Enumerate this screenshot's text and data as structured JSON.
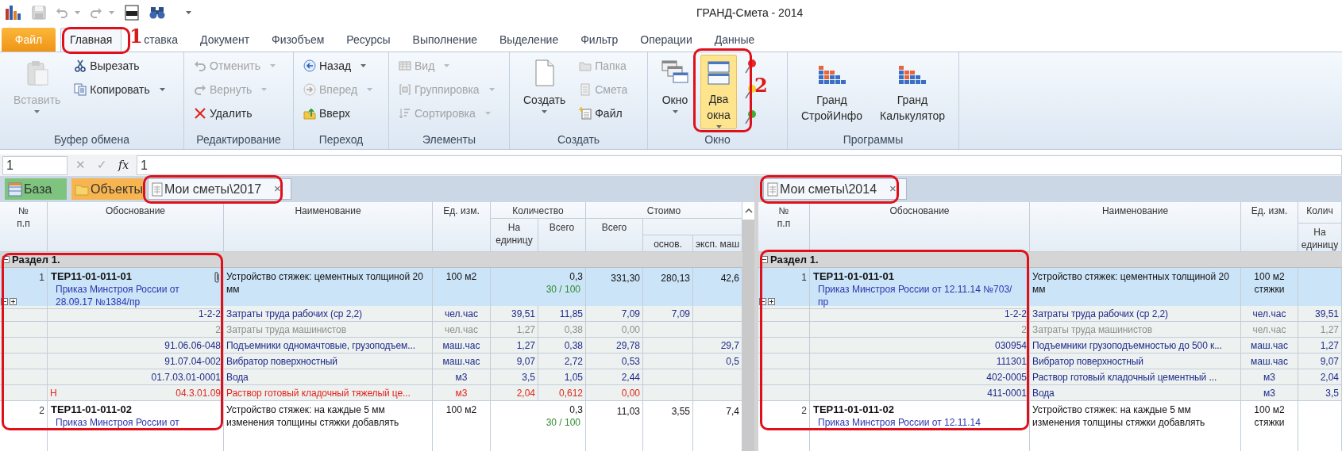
{
  "window": {
    "title": "ГРАНД-Смета - 2014"
  },
  "ribbon": {
    "tabs": [
      {
        "label": "Файл",
        "kind": "file",
        "selected": false
      },
      {
        "label": "Главная",
        "kind": "tab",
        "selected": true
      },
      {
        "label": "ставка",
        "kind": "tab",
        "selected": false
      },
      {
        "label": "Документ",
        "kind": "tab",
        "selected": false
      },
      {
        "label": "Физобъем",
        "kind": "tab",
        "selected": false
      },
      {
        "label": "Ресурсы",
        "kind": "tab",
        "selected": false
      },
      {
        "label": "Выполнение",
        "kind": "tab",
        "selected": false
      },
      {
        "label": "Выделение",
        "kind": "tab",
        "selected": false
      },
      {
        "label": "Фильтр",
        "kind": "tab",
        "selected": false
      },
      {
        "label": "Операции",
        "kind": "tab",
        "selected": false
      },
      {
        "label": "Данные",
        "kind": "tab",
        "selected": false
      }
    ],
    "groups": [
      {
        "label": "Буфер обмена",
        "buttons": [
          {
            "kind": "large",
            "label": "Вставить",
            "disabled": true,
            "dropdown": true,
            "pressed": false
          },
          {
            "kind": "small",
            "label": "Вырезать",
            "disabled": false,
            "dropdown": false,
            "pressed": false
          },
          {
            "kind": "small",
            "label": "Копировать",
            "disabled": false,
            "dropdown": true,
            "pressed": false
          }
        ]
      },
      {
        "label": "Редактирование",
        "buttons": [
          {
            "kind": "small",
            "label": "Отменить",
            "disabled": true,
            "dropdown": true,
            "pressed": false
          },
          {
            "kind": "small",
            "label": "Вернуть",
            "disabled": true,
            "dropdown": true,
            "pressed": false
          },
          {
            "kind": "small",
            "label": "Удалить",
            "disabled": false,
            "dropdown": false,
            "pressed": false
          }
        ]
      },
      {
        "label": "Переход",
        "buttons": [
          {
            "kind": "small",
            "label": "Назад",
            "disabled": false,
            "dropdown": true,
            "pressed": false
          },
          {
            "kind": "small",
            "label": "Вперед",
            "disabled": true,
            "dropdown": true,
            "pressed": false
          },
          {
            "kind": "small",
            "label": "Вверх",
            "disabled": false,
            "dropdown": false,
            "pressed": false
          }
        ]
      },
      {
        "label": "Элементы",
        "buttons": [
          {
            "kind": "small",
            "label": "Вид",
            "disabled": true,
            "dropdown": true,
            "pressed": false
          },
          {
            "kind": "small",
            "label": "Группировка",
            "disabled": true,
            "dropdown": true,
            "pressed": false
          },
          {
            "kind": "small",
            "label": "Сортировка",
            "disabled": true,
            "dropdown": true,
            "pressed": false
          }
        ]
      },
      {
        "label": "Создать",
        "buttons": [
          {
            "kind": "large",
            "label": "Создать",
            "disabled": false,
            "dropdown": true,
            "pressed": false
          },
          {
            "kind": "small",
            "label": "Папка",
            "disabled": true,
            "dropdown": false,
            "pressed": false
          },
          {
            "kind": "small",
            "label": "Смета",
            "disabled": true,
            "dropdown": false,
            "pressed": false
          },
          {
            "kind": "small",
            "label": "Файл",
            "disabled": false,
            "dropdown": false,
            "pressed": false
          }
        ]
      },
      {
        "label": "Окно",
        "buttons": [
          {
            "kind": "large",
            "label": "Окно",
            "disabled": false,
            "dropdown": true,
            "pressed": false
          },
          {
            "kind": "large",
            "label": "Два окна",
            "disabled": false,
            "dropdown": true,
            "pressed": true
          },
          {
            "kind": "pin",
            "color": "#e8262a"
          },
          {
            "kind": "pin",
            "color": "#f2d22a"
          },
          {
            "kind": "pin",
            "color": "#3fae35"
          }
        ]
      },
      {
        "label": "Программы",
        "buttons": [
          {
            "kind": "large",
            "label": "Гранд СтройИнфо",
            "disabled": false,
            "dropdown": false,
            "pressed": false
          },
          {
            "kind": "large",
            "label": "Гранд Калькулятор",
            "disabled": false,
            "dropdown": false,
            "pressed": false
          }
        ]
      }
    ]
  },
  "formula_bar": {
    "cell": "1",
    "buttons": [
      {
        "glyph": "✕",
        "disabled": true
      },
      {
        "glyph": "✓",
        "disabled": true
      },
      {
        "glyph": "fx",
        "disabled": false
      }
    ],
    "value": "1"
  },
  "panes": [
    {
      "tabs": [
        {
          "label": "База",
          "kind": "base",
          "selected": false
        },
        {
          "label": "Объекты",
          "kind": "objects",
          "selected": false
        },
        {
          "label": "Мои сметы\\2017",
          "kind": "estimate",
          "selected": true,
          "close": "×"
        }
      ],
      "columns": [
        {
          "label": "№ п.п"
        },
        {
          "label": "Обоснование"
        },
        {
          "label": "Наименование"
        },
        {
          "label": "Ед. изм."
        },
        {
          "label": "Количество",
          "children": [
            {
              "label": "На единицу"
            },
            {
              "label": "Всего"
            }
          ]
        },
        {
          "label": "Стоимо",
          "children": [
            {
              "label": "Всего"
            },
            {
              "children": [
                {
                  "label": "основ."
                },
                {
                  "label": "эксп. маш"
                }
              ]
            }
          ]
        }
      ],
      "rows": [
        {
          "kind": "section",
          "label": "Раздел 1."
        },
        {
          "kind": "item",
          "selected": true,
          "number": "1",
          "code": "ТЕР11-01-011-01",
          "order": "Приказ Минстроя России от 28.09.17 №1384/пр",
          "attachment": true,
          "tree_toggles": true,
          "name": "Устройство стяжек: цементных толщиной 20 мм",
          "unit": "100 м2",
          "quantity": "0,3",
          "ratio": "30 / 100",
          "total": "331,30",
          "base": "280,13",
          "machine": "42,6"
        },
        {
          "kind": "resource",
          "greyed": false,
          "missing": false,
          "code": "1-2-2",
          "name": "Затраты труда рабочих (ср 2,2)",
          "unit": "чел.час",
          "per_unit": "39,51",
          "quantity": "11,85",
          "total": "7,09",
          "base": "7,09"
        },
        {
          "kind": "resource",
          "greyed": true,
          "missing": false,
          "code": "2",
          "name": "Затраты труда машинистов",
          "unit": "чел.час",
          "per_unit": "1,27",
          "quantity": "0,38",
          "total": "0,00"
        },
        {
          "kind": "resource",
          "greyed": false,
          "missing": false,
          "code": "91.06.06-048",
          "name": "Подъемники одномачтовые, грузоподъем...",
          "unit": "маш.час",
          "per_unit": "1,27",
          "quantity": "0,38",
          "total": "29,78",
          "machine": "29,7"
        },
        {
          "kind": "resource",
          "greyed": false,
          "missing": false,
          "code": "91.07.04-002",
          "name": "Вибратор поверхностный",
          "unit": "маш.час",
          "per_unit": "9,07",
          "quantity": "2,72",
          "total": "0,53",
          "machine": "0,5"
        },
        {
          "kind": "resource",
          "greyed": false,
          "missing": false,
          "code": "01.7.03.01-0001",
          "name": "Вода",
          "unit": "м3",
          "per_unit": "3,5",
          "quantity": "1,05",
          "total": "2,44"
        },
        {
          "kind": "resource",
          "greyed": false,
          "missing": true,
          "marker": "Н",
          "code": "04.3.01.09",
          "name": "Раствор готовый кладочный тяжелый це...",
          "unit": "м3",
          "per_unit": "2,04",
          "quantity": "0,612",
          "total": "0,00"
        },
        {
          "kind": "item",
          "selected": false,
          "number": "2",
          "code": "ТЕР11-01-011-02",
          "order": "Приказ Минстроя России от",
          "name": "Устройство стяжек: на каждые 5 мм изменения толщины стяжки добавлять",
          "unit": "100 м2",
          "quantity": "0,3",
          "ratio": "30 / 100",
          "total": "11,03",
          "base": "3,55",
          "machine": "7,4"
        }
      ]
    },
    {
      "tabs": [
        {
          "label": "Мои сметы\\2014",
          "kind": "estimate",
          "selected": true,
          "close": "×"
        }
      ],
      "columns": [
        {
          "label": "№ п.п"
        },
        {
          "label": "Обоснование"
        },
        {
          "label": "Наименование"
        },
        {
          "label": "Ед. изм."
        },
        {
          "label": "Колич",
          "children": [
            {
              "label": "На единицу"
            }
          ]
        }
      ],
      "rows": [
        {
          "kind": "section",
          "label": "Раздел 1."
        },
        {
          "kind": "item",
          "selected": true,
          "number": "1",
          "code": "ТЕР11-01-011-01",
          "order": "Приказ Минстроя России от 12.11.14 №703/пр",
          "tree_toggles": true,
          "name": "Устройство стяжек: цементных толщиной 20 мм",
          "unit": "100 м2 стяжки"
        },
        {
          "kind": "resource",
          "greyed": false,
          "missing": false,
          "code": "1-2-2",
          "name": "Затраты труда рабочих (ср 2,2)",
          "unit": "чел.час",
          "per_unit": "39,51"
        },
        {
          "kind": "resource",
          "greyed": true,
          "missing": false,
          "code": "2",
          "name": "Затраты труда машинистов",
          "unit": "чел.час",
          "per_unit": "1,27"
        },
        {
          "kind": "resource",
          "greyed": false,
          "missing": false,
          "code": "030954",
          "name": "Подъемники грузоподъемностью до 500 к...",
          "unit": "маш.час",
          "per_unit": "1,27"
        },
        {
          "kind": "resource",
          "greyed": false,
          "missing": false,
          "code": "111301",
          "name": "Вибратор поверхностный",
          "unit": "маш.час",
          "per_unit": "9,07"
        },
        {
          "kind": "resource",
          "greyed": false,
          "missing": false,
          "code": "402-0005",
          "name": "Раствор готовый кладочный цементный ...",
          "unit": "м3",
          "per_unit": "2,04"
        },
        {
          "kind": "resource",
          "greyed": false,
          "missing": false,
          "code": "411-0001",
          "name": "Вода",
          "unit": "м3",
          "per_unit": "3,5"
        },
        {
          "kind": "item",
          "selected": false,
          "number": "2",
          "code": "ТЕР11-01-011-02",
          "order": "Приказ Минстроя России от 12.11.14",
          "name": "Устройство стяжек: на каждые 5 мм изменения толщины стяжки добавлять",
          "unit": "100 м2 стяжки"
        }
      ]
    }
  ],
  "annotations": [
    {
      "kind": "frame"
    },
    {
      "kind": "frame"
    },
    {
      "kind": "frame"
    },
    {
      "kind": "frame"
    },
    {
      "kind": "frame"
    },
    {
      "kind": "frame"
    },
    {
      "kind": "number",
      "label": "1"
    },
    {
      "kind": "number",
      "label": "2"
    }
  ]
}
